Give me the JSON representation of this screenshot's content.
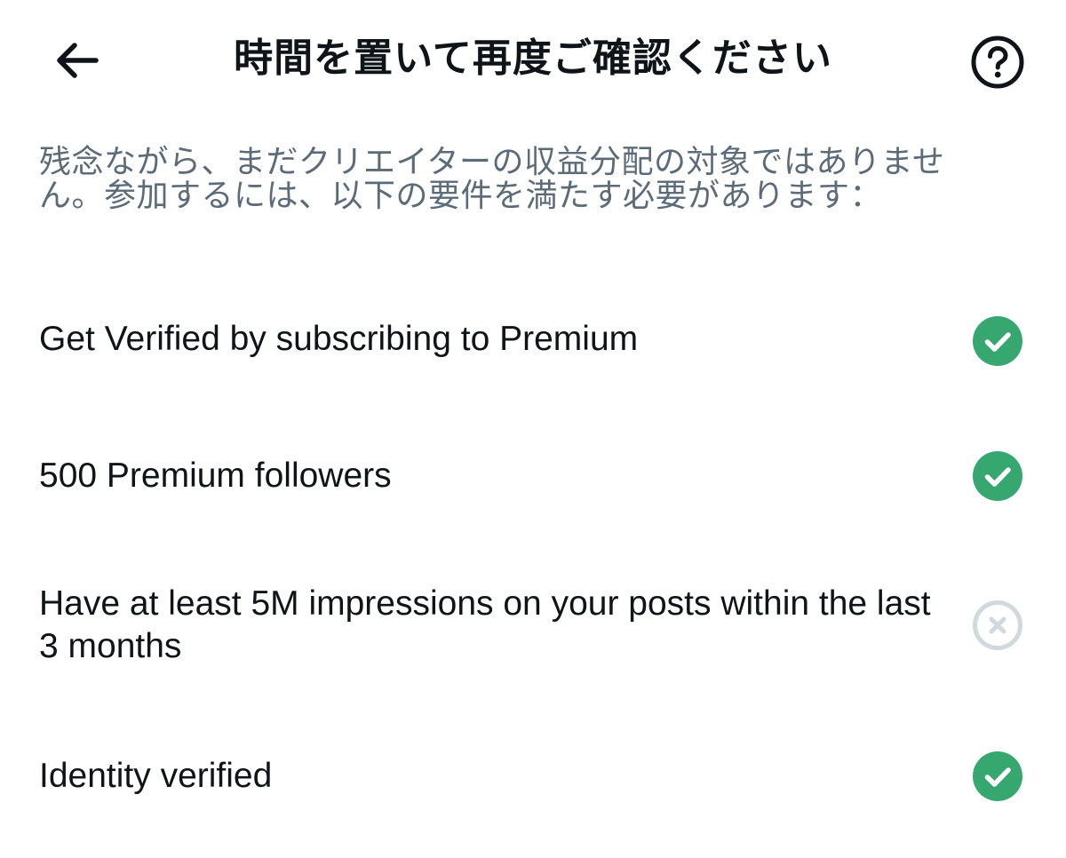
{
  "header": {
    "back_icon": "arrow-left-icon",
    "title": "時間を置いて再度ご確認ください",
    "help_icon": "question-circle-icon"
  },
  "description": "残念ながら、まだクリエイターの収益分配の対象ではありません。参加するには、以下の要件を満たす必要があります：",
  "requirements": [
    {
      "label": "Get Verified by subscribing to Premium",
      "status": "met",
      "icon": "check-circle-icon"
    },
    {
      "label": "500 Premium followers",
      "status": "met",
      "icon": "check-circle-icon"
    },
    {
      "label": "Have at least 5M impressions on your posts within the last 3 months",
      "status": "not-met",
      "icon": "x-circle-icon"
    },
    {
      "label": "Identity verified",
      "status": "met",
      "icon": "check-circle-icon"
    }
  ],
  "colors": {
    "met": "#36a86f",
    "not_met": "#cfd9de",
    "text": "#0f1419",
    "secondary_text": "#5b6b78"
  }
}
